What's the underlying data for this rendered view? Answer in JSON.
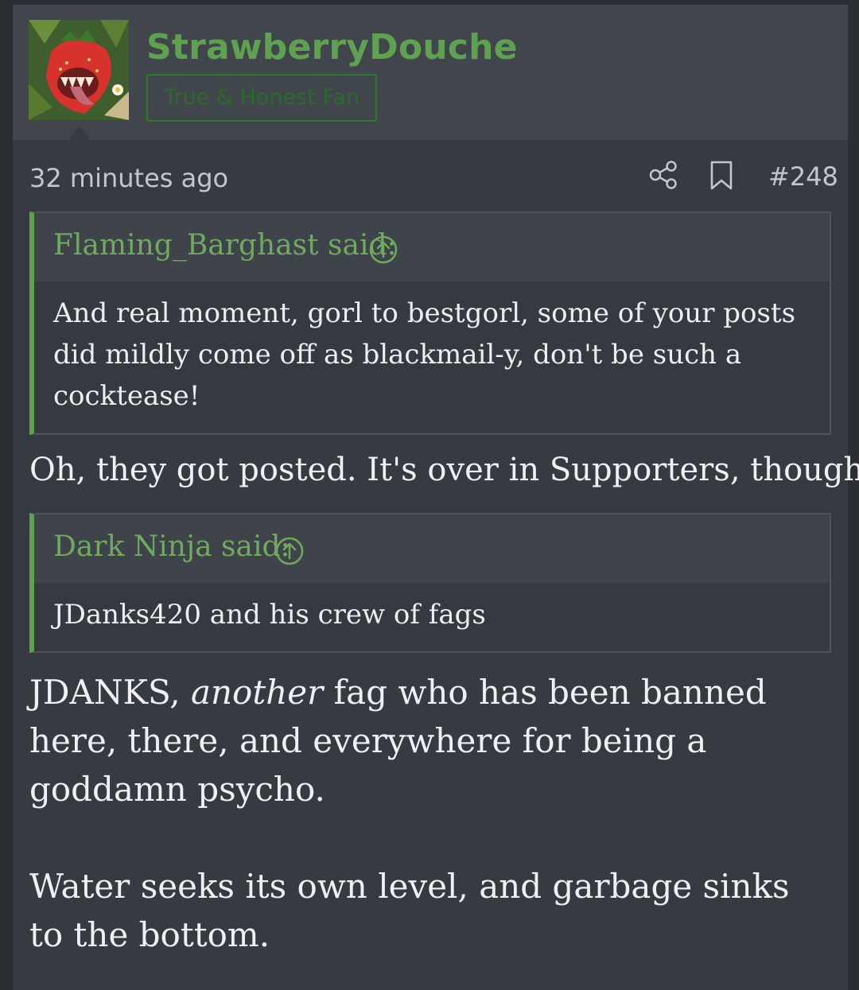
{
  "user": {
    "name": "StrawberryDouche",
    "title": "True & Honest Fan",
    "avatar": "strawberry-monster-avatar"
  },
  "post": {
    "time": "32 minutes ago",
    "number": "#248",
    "icons": [
      "share-icon",
      "bookmark-icon"
    ]
  },
  "quotes": [
    {
      "author": "Flaming_Barghast said:",
      "body": "And real moment, gorl to bestgorl, some of your posts did mildly come off as blackmail-y, don't be such a cocktease!"
    },
    {
      "author": "Dark Ninja said:",
      "body": "JDanks420 and his crew of fags"
    }
  ],
  "paragraphs": {
    "p1": "Oh, they got posted. It's over in Supporters, though.",
    "p2_start": "JDANKS, ",
    "p2_em": "another",
    "p2_end": " fag who has been banned here, there, and everywhere for being a goddamn psycho.",
    "p3": "Water seeks its own level, and garbage sinks to the bottom."
  },
  "colors": {
    "accent": "#5ea150",
    "background": "#363a41",
    "header": "#41454c"
  }
}
